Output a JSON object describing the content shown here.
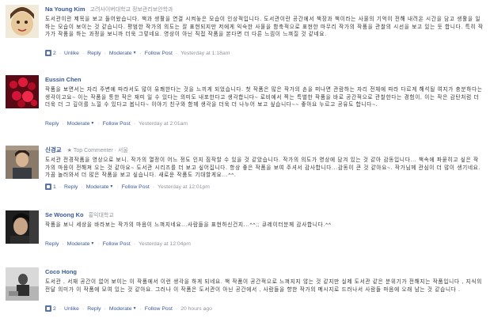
{
  "comments": [
    {
      "author": "Na Young Kim",
      "affiliation": "고려사이버대학교 정보관리보안학과",
      "text": "도서관이란 제목을 보고 들어왔습니다. 책과 생활을 연결 시켜놓은 모습이 인상적입니다. 도서관이란 공간에서 책장과 책이라는 사물의 기억이 전해 내려온 시간을 담고 생활을 일하는 모습이 보이는 것 같습니다. 평범한 작가의 의도는 잘 표현되지만 저에게 익숙한 사물을 함축적으로 표현한 마무리 작가의 작품을 관찰의 시선을 보고 있는 듯 합니다. 특히 작가가 작품을 하는 과정을 보니까 더욱 그렇네요. 영상이 아닌 직접 작품을 본다면 더 다른 느낌이 느껴질 것 같네요.",
      "like_count": "2",
      "unlike": "Unlike",
      "reply": "Reply",
      "moderate": "Moderate",
      "follow": "Follow Post",
      "time": "Yesterday at 1:18am"
    },
    {
      "author": "Eussin Chen",
      "affiliation": "",
      "text": "작품을 보면서는 자리 주변에 따라서도 많이 유쾌한다는 것을 느끼게 되었습니다. 첫 작품은 많은 작가의 손을 떠나면 관람하는 자리 전체에 따라 다르게 해석될 여지가 충분하다는 생각이고요~ 이는 작품을 통한 작은 재미 일 수 있다는 의미도 내포한다고 생각합니다~ 로비에서 찍는 특별한 작품을 바로 공간적으로 관찰한다는 경험이, 이는 작은 감탄처럼 더 더욱 더 그 깊이를 느낄 수 있다고 봅니다~ 이야기 친구와 함께 생각을 더욱 더 나누어 보고 싶습니다~~ 좋아요 누르고 공유도 합니다~.",
      "like_count": "",
      "unlike": "",
      "reply": "Reply",
      "moderate": "Moderate",
      "follow": "Follow Post",
      "time": "Yesterday at 2:01am"
    },
    {
      "author": "신경교",
      "affiliation": "",
      "badge": "Top Commenter · 서울",
      "text": "도서관 전경작품을 영상으로 보니, 작가의 열정이 어느 정도 인지 짐작할 수 있을 것 같았습니다. 작가의 의도가 영상에 담겨 있는 것 같아 감동입니다... 책속에 파묻히고 싶은 작가의 마음이 전해져 오는 것 같아요~ 도서관 시리즈를 더 보고 싶어집니다. 항상 좋은 작품을 보여 주셔서 감사합니다...감동이 큰 것 같아요~. 작가님께 관심이 더 많이 생기네요. 가끔 놀러와서 더 많은 작품을 보고 싶습니다. 새로운 작품도 기대할게요...^^.",
      "like_count": "1",
      "unlike": "",
      "reply": "Reply",
      "moderate": "Moderate",
      "follow": "Follow Post",
      "time": "Yesterday at 12:01pm"
    },
    {
      "author": "Se Woong Ko",
      "affiliation": "홍익대학교",
      "text": "작품을 보니 세상을 바라보는 작가의 마음이 느껴지네요...사람들을 표현하신건지...^^;; 큐레이터분께 감사합니다.^^",
      "like_count": "",
      "unlike": "",
      "reply": "Reply",
      "moderate": "Moderate",
      "follow": "Follow Post",
      "time": "Yesterday at 12:04pm"
    },
    {
      "author": "Coco Hong",
      "affiliation": "",
      "text": "도서관 , 서재 공간이 없어 보이는 이 작품에서 이런 생각을 하게 되네요. 책 작품이 공간적으로 느껴지지 않는 것 같지만 실제 도서관 같은 분위기가 전해지는 작품입니다 , 지식의 전달 의미가 이 작품에 모여 있는 것 같아요. 그러나 이 작품은 도서관이 아닌 공간에서 , 사람들을 향한 작가의 메시지로 드러나서 사람들 마음에 오래 남는 것 같습니다 .",
      "like_count": "2",
      "unlike": "Unlike",
      "reply": "Reply",
      "moderate": "Moderate",
      "follow": "Follow Post",
      "time": "20 hours ago"
    }
  ]
}
